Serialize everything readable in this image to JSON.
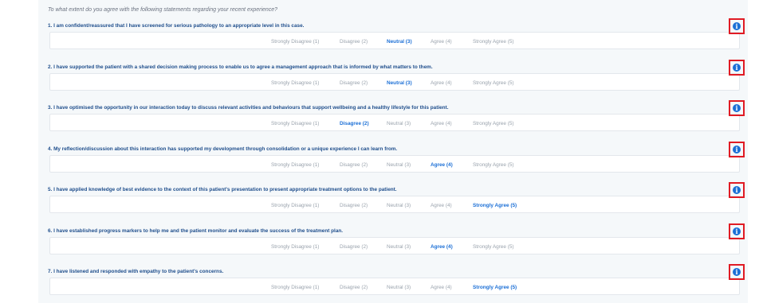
{
  "intro": "To what extent do you agree with the following statements regarding your recent experience?",
  "info_icon_glyph": "i",
  "questions": [
    {
      "text": "1. I am confident/reassured that I have screened for serious pathology to an appropriate level in this case.",
      "options": [
        "Strongly Disagree (1)",
        "Disagree (2)",
        "Neutral (3)",
        "Agree (4)",
        "Strongly Agree (5)"
      ],
      "selected": 2
    },
    {
      "text": "2. I have supported the patient with a shared decision making process to enable us to agree a management approach that is informed by what matters to them.",
      "options": [
        "Strongly Disagree (1)",
        "Disagree (2)",
        "Neutral (3)",
        "Agree (4)",
        "Strongly Agree (5)"
      ],
      "selected": 2
    },
    {
      "text": "3. I have optimised the opportunity in our interaction today to discuss relevant activities and behaviours that support wellbeing and a healthy lifestyle for this patient.",
      "options": [
        "Strongly Disagree (1)",
        "Disagree (2)",
        "Neutral (3)",
        "Agree (4)",
        "Strongly Agree (5)"
      ],
      "selected": 1
    },
    {
      "text": "4. My reflection/discussion about this interaction has supported my development through consolidation or a unique experience I can learn from.",
      "options": [
        "Strongly Disagree (1)",
        "Disagree (2)",
        "Neutral (3)",
        "Agree (4)",
        "Strongly Agree (5)"
      ],
      "selected": 3
    },
    {
      "text": "5. I have applied knowledge of best evidence to the context of this patient's presentation to present appropriate treatment options to the patient.",
      "options": [
        "Strongly Disagree (1)",
        "Disagree (2)",
        "Neutral (3)",
        "Agree (4)",
        "Strongly Agree (5)"
      ],
      "selected": 4
    },
    {
      "text": "6. I have established progress markers to help me and the patient monitor and evaluate the success of the treatment plan.",
      "options": [
        "Strongly Disagree (1)",
        "Disagree (2)",
        "Neutral (3)",
        "Agree (4)",
        "Strongly Agree (5)"
      ],
      "selected": 3
    },
    {
      "text": "7. I have listened and responded with empathy to the patient's concerns.",
      "options": [
        "Strongly Disagree (1)",
        "Disagree (2)",
        "Neutral (3)",
        "Agree (4)",
        "Strongly Agree (5)"
      ],
      "selected": 4
    }
  ],
  "colors": {
    "question_text": "#1f4e8c",
    "selected_option": "#1b6fd6",
    "unselected_option": "#9aa3ad",
    "info_highlight": "#e01b24",
    "info_icon": "#1b6fd6"
  }
}
